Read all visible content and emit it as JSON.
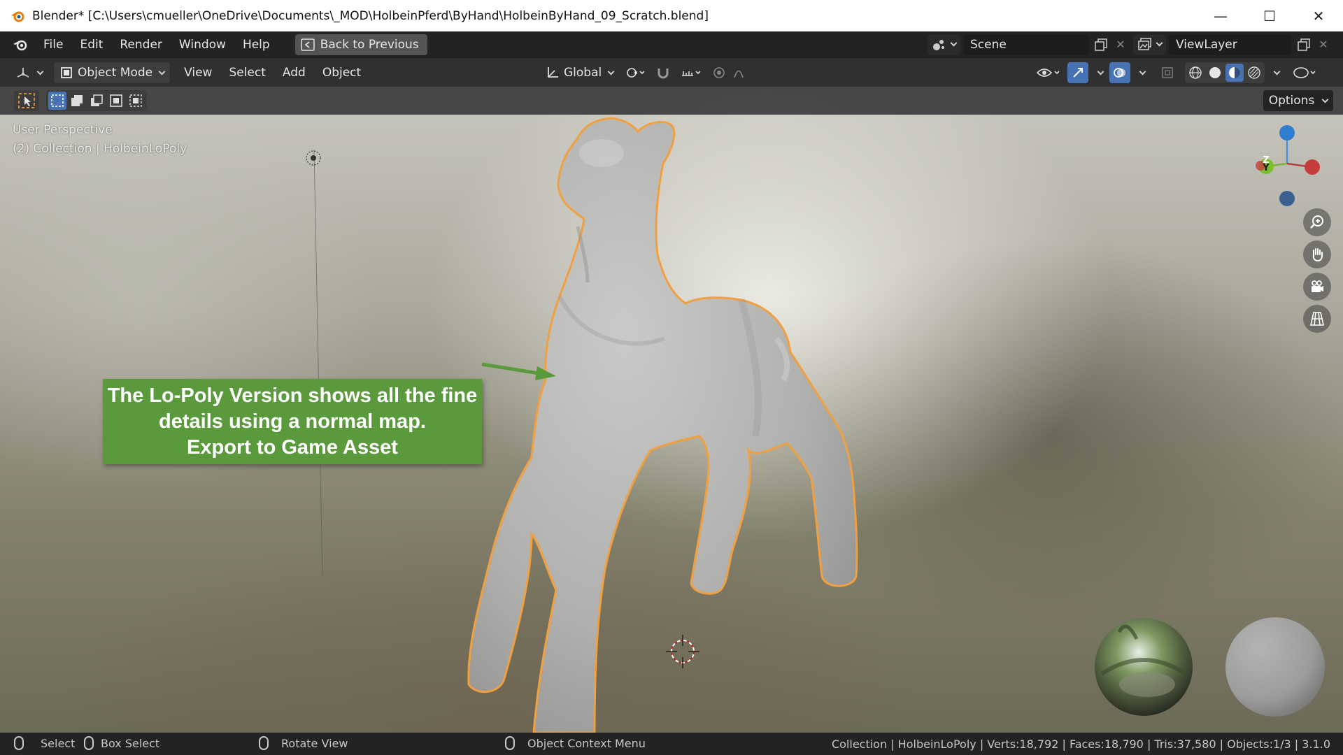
{
  "window": {
    "title": "Blender* [C:\\Users\\cmueller\\OneDrive\\Documents\\_MOD\\HolbeinPferd\\ByHand\\HolbeinByHand_09_Scratch.blend]",
    "minimize": "—",
    "maximize": "☐",
    "close": "✕"
  },
  "menubar": {
    "items": [
      "File",
      "Edit",
      "Render",
      "Window",
      "Help"
    ],
    "back_button": "Back to Previous",
    "scene_name": "Scene",
    "view_layer": "ViewLayer"
  },
  "viewport_header": {
    "mode": "Object Mode",
    "menus": [
      "View",
      "Select",
      "Add",
      "Object"
    ],
    "transform_orientation": "Global"
  },
  "tool_settings": {
    "options_label": "Options"
  },
  "viewport": {
    "perspective_label": "User Perspective",
    "collection_label": "(2) Collection | HolbeinLoPoly",
    "gizmo_axes": [
      "Z",
      "Y"
    ],
    "callout_lines": [
      "The Lo-Poly Version shows all the fine",
      "details using a normal map.",
      "Export to Game Asset"
    ],
    "callout_color": "#5b9a3c",
    "selection_outline_color": "#f0a040"
  },
  "statusbar": {
    "select": "Select",
    "box_select": "Box Select",
    "rotate_view": "Rotate View",
    "context_menu": "Object Context Menu",
    "stats": "Collection | HolbeinLoPoly | Verts:18,792 | Faces:18,790 | Tris:37,580 | Objects:1/3 | 3.1.0"
  }
}
